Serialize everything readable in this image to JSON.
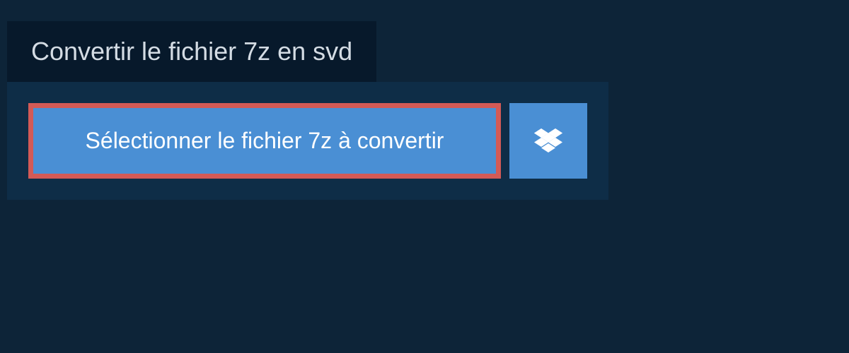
{
  "title": "Convertir le fichier 7z en svd",
  "buttons": {
    "select_file": "Sélectionner le fichier 7z à convertir"
  },
  "colors": {
    "page_bg": "#0d2438",
    "title_bg": "#07192b",
    "panel_bg": "#0e2d47",
    "button_bg": "#4a8fd4",
    "highlight_border": "#d35a56",
    "text_light": "#d4dce4",
    "text_white": "#ffffff"
  }
}
